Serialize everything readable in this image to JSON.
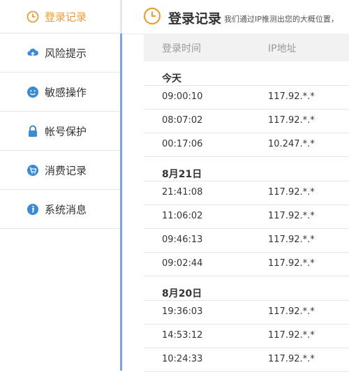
{
  "sidebar": {
    "items": [
      {
        "label": "登录记录",
        "icon": "clock-icon",
        "active": true
      },
      {
        "label": "风险提示",
        "icon": "cloud-upload-icon"
      },
      {
        "label": "敏感操作",
        "icon": "smiley-icon"
      },
      {
        "label": "帐号保护",
        "icon": "lock-icon"
      },
      {
        "label": "消费记录",
        "icon": "cart-icon"
      },
      {
        "label": "系统消息",
        "icon": "info-icon"
      }
    ]
  },
  "header": {
    "title": "登录记录",
    "description": "我们通过IP推测出您的大概位置，"
  },
  "table": {
    "columns": [
      "登录时间",
      "IP地址"
    ],
    "groups": [
      {
        "date": "今天",
        "rows": [
          {
            "time": "09:00:10",
            "ip": "117.92.*.*"
          },
          {
            "time": "08:07:02",
            "ip": "117.92.*.*"
          },
          {
            "time": "00:17:06",
            "ip": "10.247.*.*"
          }
        ]
      },
      {
        "date": "8月21日",
        "rows": [
          {
            "time": "21:41:08",
            "ip": "117.92.*.*"
          },
          {
            "time": "11:06:02",
            "ip": "117.92.*.*"
          },
          {
            "time": "09:46:13",
            "ip": "117.92.*.*"
          },
          {
            "time": "09:02:44",
            "ip": "117.92.*.*"
          }
        ]
      },
      {
        "date": "8月20日",
        "rows": [
          {
            "time": "19:36:03",
            "ip": "117.92.*.*"
          },
          {
            "time": "14:53:12",
            "ip": "117.92.*.*"
          },
          {
            "time": "10:24:33",
            "ip": "117.92.*.*"
          }
        ]
      }
    ]
  },
  "colors": {
    "accent": "#e99d3a",
    "icon_blue": "#3a8ad6",
    "divider_blue": "#7aa7d3"
  }
}
